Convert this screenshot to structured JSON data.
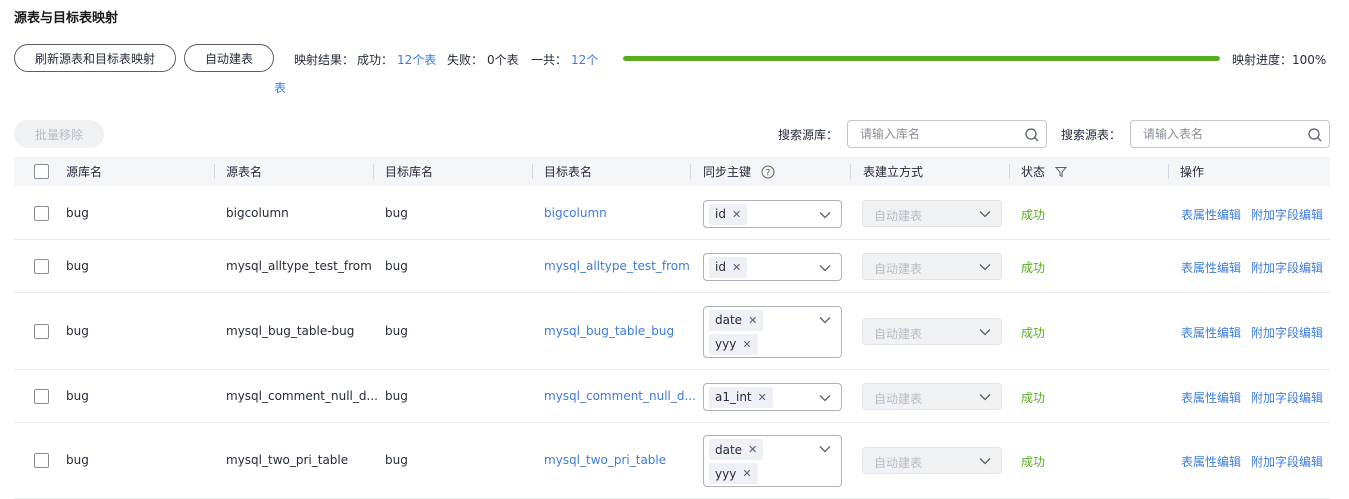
{
  "title": "源表与目标表映射",
  "toolbar": {
    "refresh_label": "刷新源表和目标表映射",
    "auto_create_label": "自动建表",
    "batch_remove_label": "批量移除"
  },
  "result": {
    "prefix": "映射结果：",
    "success_label": "成功：",
    "success_value": "12个表",
    "fail_label": "失败：",
    "fail_value": "0个表",
    "total_label": "一共：",
    "total_value_line1": "12个",
    "total_value_line2": "表",
    "progress_label": "映射进度：100%",
    "progress_percent": 100,
    "progress_color": "#5aad23"
  },
  "search": {
    "source_db_label": "搜索源库：",
    "source_db_placeholder": "请输入库名",
    "source_table_label": "搜索源表：",
    "source_table_placeholder": "请输入表名"
  },
  "columns": {
    "source_db": "源库名",
    "source_table": "源表名",
    "target_db": "目标库名",
    "target_table": "目标表名",
    "sync_pk": "同步主键",
    "create_mode": "表建立方式",
    "status": "状态",
    "actions": "操作"
  },
  "rows": [
    {
      "source_db": "bug",
      "source_table": "bigcolumn",
      "target_db": "bug",
      "target_table": "bigcolumn",
      "keys": [
        "id"
      ],
      "create_mode": "自动建表",
      "status": "成功",
      "op1": "表属性编辑",
      "op2": "附加字段编辑"
    },
    {
      "source_db": "bug",
      "source_table": "mysql_alltype_test_from",
      "target_db": "bug",
      "target_table": "mysql_alltype_test_from",
      "keys": [
        "id"
      ],
      "create_mode": "自动建表",
      "status": "成功",
      "op1": "表属性编辑",
      "op2": "附加字段编辑"
    },
    {
      "source_db": "bug",
      "source_table": "mysql_bug_table-bug",
      "target_db": "bug",
      "target_table": "mysql_bug_table_bug",
      "keys": [
        "date",
        "yyy"
      ],
      "create_mode": "自动建表",
      "status": "成功",
      "op1": "表属性编辑",
      "op2": "附加字段编辑"
    },
    {
      "source_db": "bug",
      "source_table": "mysql_comment_null_d...",
      "target_db": "bug",
      "target_table": "mysql_comment_null_d...",
      "keys": [
        "a1_int"
      ],
      "create_mode": "自动建表",
      "status": "成功",
      "op1": "表属性编辑",
      "op2": "附加字段编辑"
    },
    {
      "source_db": "bug",
      "source_table": "mysql_two_pri_table",
      "target_db": "bug",
      "target_table": "mysql_two_pri_table",
      "keys": [
        "date",
        "yyy"
      ],
      "create_mode": "自动建表",
      "status": "成功",
      "op1": "表属性编辑",
      "op2": "附加字段编辑"
    }
  ],
  "icons": {
    "search": "search-icon",
    "help": "help-circle-icon",
    "filter": "filter-icon",
    "close": "close-icon",
    "chevron": "chevron-down-icon"
  },
  "colors": {
    "link": "#3c7bdc",
    "success": "#5aad23"
  }
}
